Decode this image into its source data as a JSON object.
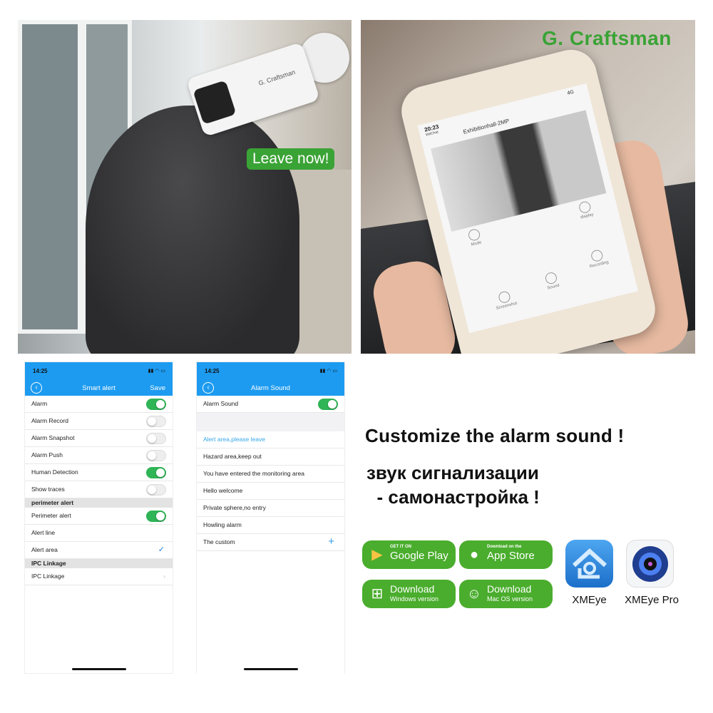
{
  "photo_left": {
    "camera_brand": "G. Craftsman",
    "speech_bubble": "Leave now!"
  },
  "photo_right": {
    "brand_logo": "G. Craftsman",
    "phone_screen": {
      "time": "20:23",
      "back_app": "WeChat",
      "network": "4G",
      "title": "Exhibitionhall-2MP",
      "buttons": [
        "Mode",
        "display",
        "Screenshot",
        "Sound",
        "Recording"
      ]
    }
  },
  "smart_alert_screen": {
    "time": "14:25",
    "title": "Smart alert",
    "save_label": "Save",
    "rows": [
      {
        "label": "Alarm",
        "toggle": true
      },
      {
        "label": "Alarm Record",
        "toggle": false
      },
      {
        "label": "Alarm Snapshot",
        "toggle": false
      },
      {
        "label": "Alarm Push",
        "toggle": false
      },
      {
        "label": "Human Detection",
        "toggle": true
      },
      {
        "label": "Show traces",
        "toggle": false
      }
    ],
    "section_perimeter": "perimeter alert",
    "perimeter_alert": {
      "label": "Perimeter alert",
      "toggle": true
    },
    "alert_line": "Alert line",
    "alert_area": "Alert area",
    "section_ipc": "IPC Linkage",
    "ipc_linkage": "IPC Linkage"
  },
  "alarm_sound_screen": {
    "time": "14:25",
    "title": "Alarm Sound",
    "alarm_sound": {
      "label": "Alarm Sound",
      "toggle": true
    },
    "sounds": [
      "Alert area,please leave",
      "Hazard area,keep out",
      "You have entered the monitoring area",
      "Hello welcome",
      "Private sphere,no entry",
      "Howling alarm"
    ],
    "selected_index": 0,
    "custom": "The custom"
  },
  "headline": "Customize the alarm sound !",
  "headline_ru_1": "звук сигнализации",
  "headline_ru_2": "  - самонастройка !",
  "badges": {
    "google_play": {
      "small": "GET IT ON",
      "large": "Google Play"
    },
    "app_store": {
      "small": "Download on the",
      "large": "App Store"
    },
    "windows": {
      "large": "Download",
      "sub": "Windows version"
    },
    "mac": {
      "large": "Download",
      "sub": "Mac OS version"
    }
  },
  "apps": [
    {
      "name": "XMEye"
    },
    {
      "name": "XMEye Pro"
    }
  ],
  "colors": {
    "accent_green": "#4aad2d",
    "header_blue": "#1d9bf0",
    "toggle_green": "#2fb456",
    "selected_blue": "#36a7ea"
  }
}
